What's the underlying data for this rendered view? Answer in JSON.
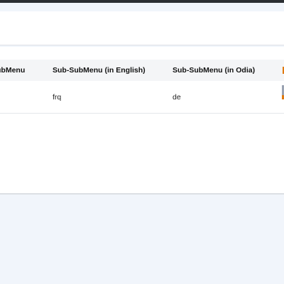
{
  "table": {
    "headers": [
      "SubMenu",
      "Sub-SubMenu (in English)",
      "Sub-SubMenu (in Odia)",
      ""
    ],
    "rows": [
      [
        "",
        "frq",
        "de",
        ""
      ]
    ]
  },
  "colors": {
    "page_bg": "#f1f5fb",
    "header_row_bg": "#f4f5f7",
    "accent_icon": "#e07a10"
  },
  "icons": {
    "row_action": "edit-icon"
  }
}
